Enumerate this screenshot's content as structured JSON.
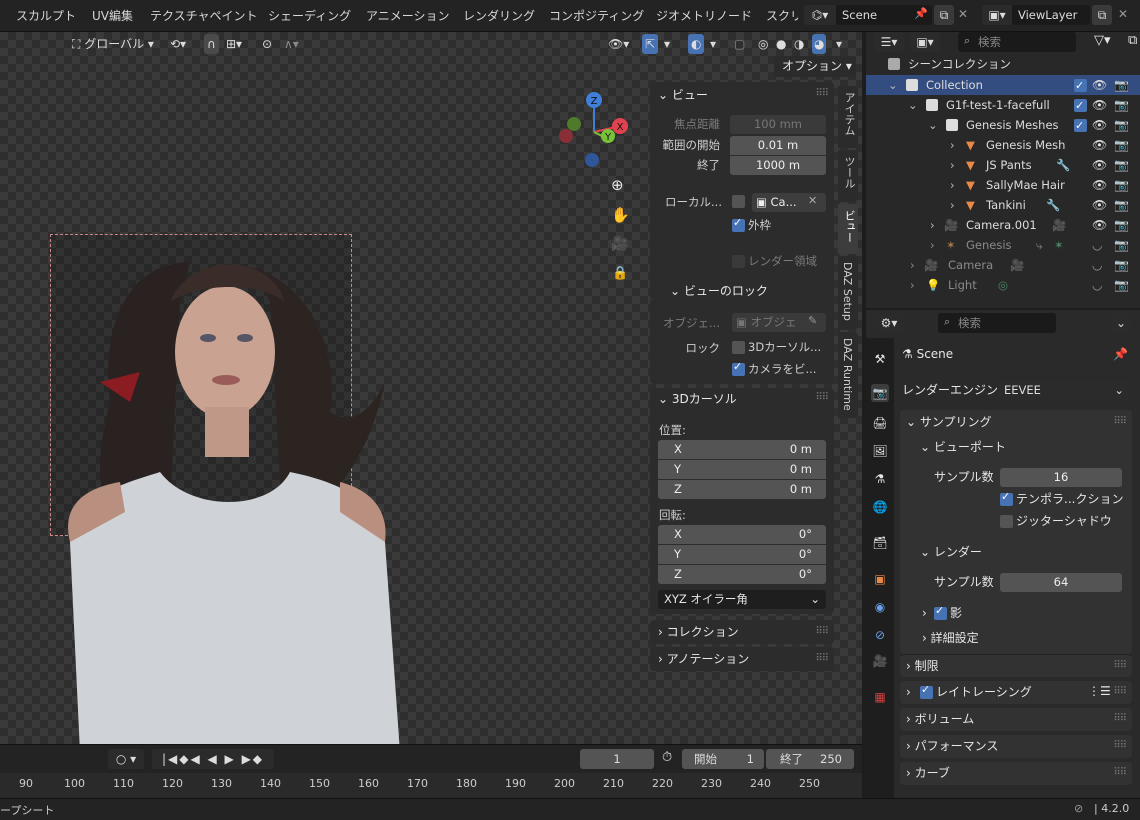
{
  "topbar": {
    "workspaces": [
      "スカルプト",
      "UV編集",
      "テクスチャペイント",
      "シェーディング",
      "アニメーション",
      "レンダリング",
      "コンポジティング",
      "ジオメトリノード",
      "スクリ"
    ],
    "scene": "Scene",
    "view_layer": "ViewLayer"
  },
  "viewport": {
    "transform_orientation": "グローバル",
    "options_label": "オプション",
    "gizmo_axes": {
      "z": "Z",
      "y": "Y",
      "x": "X"
    }
  },
  "npanel": {
    "tabs": [
      "アイテム",
      "ツール",
      "ビュー",
      "DAZ Setup",
      "DAZ Runtime"
    ],
    "view": {
      "title": "ビュー",
      "focal_label": "焦点距離",
      "focal_value": "100 mm",
      "clip_start_label": "範囲の開始",
      "clip_start_value": "0.01 m",
      "clip_end_label": "終了",
      "clip_end_value": "1000 m",
      "local_camera_label": "ローカル...",
      "local_camera_value": "Ca...",
      "outline_label": "外枠",
      "render_region_label": "レンダー領域",
      "lock_title": "ビューのロック",
      "lock_object_label": "オブジェ...",
      "lock_object_value": "オブジェ",
      "lock_label": "ロック",
      "lock_cursor_label": "3Dカーソル...",
      "lock_camera_label": "カメラをビ..."
    },
    "cursor": {
      "title": "3Dカーソル",
      "location_label": "位置:",
      "rotation_label": "回転:",
      "loc": [
        {
          "axis": "X",
          "value": "0 m"
        },
        {
          "axis": "Y",
          "value": "0 m"
        },
        {
          "axis": "Z",
          "value": "0 m"
        }
      ],
      "rot": [
        {
          "axis": "X",
          "value": "0°"
        },
        {
          "axis": "Y",
          "value": "0°"
        },
        {
          "axis": "Z",
          "value": "0°"
        }
      ],
      "rotation_mode": "XYZ オイラー角"
    },
    "collection_title": "コレクション",
    "annotation_title": "アノテーション"
  },
  "timeline": {
    "current_frame": "1",
    "start_label": "開始",
    "start_value": "1",
    "end_label": "終了",
    "end_value": "250",
    "ticks": [
      "90",
      "100",
      "110",
      "120",
      "130",
      "140",
      "150",
      "160",
      "170",
      "180",
      "190",
      "200",
      "210",
      "220",
      "230",
      "240",
      "250"
    ]
  },
  "statusbar": {
    "left": "ープシート",
    "version": "4.2.0"
  },
  "outliner": {
    "search_placeholder": "検索",
    "rows": [
      {
        "label": "シーンコレクション"
      },
      {
        "label": "Collection"
      },
      {
        "label": "G1f-test-1-facefull"
      },
      {
        "label": "Genesis Meshes"
      },
      {
        "label": "Genesis Mesh"
      },
      {
        "label": "JS Pants"
      },
      {
        "label": "SallyMae Hair"
      },
      {
        "label": "Tankini"
      },
      {
        "label": "Camera.001"
      },
      {
        "label": "Genesis"
      },
      {
        "label": "Camera"
      },
      {
        "label": "Light"
      }
    ]
  },
  "properties": {
    "search_placeholder": "検索",
    "scene_name": "Scene",
    "render_engine_label": "レンダーエンジン",
    "render_engine": "EEVEE",
    "sampling_title": "サンプリング",
    "viewport_title": "ビューポート",
    "viewport_samples_label": "サンプル数",
    "viewport_samples": "16",
    "temporal_label": "テンポラ...クション",
    "jitter_label": "ジッターシャドウ",
    "render_title": "レンダー",
    "render_samples_label": "サンプル数",
    "render_samples": "64",
    "shadows_label": "影",
    "advanced_label": "詳細設定",
    "limits_title": "制限",
    "raytracing_title": "レイトレーシング",
    "volumes_title": "ボリューム",
    "performance_title": "パフォーマンス",
    "curves_title": "カーブ"
  },
  "colors": {
    "accent": "#4772b3",
    "selection": "#334d80",
    "x_axis": "#e0434f",
    "y_axis": "#78c23a",
    "z_axis": "#3f7fd9"
  }
}
